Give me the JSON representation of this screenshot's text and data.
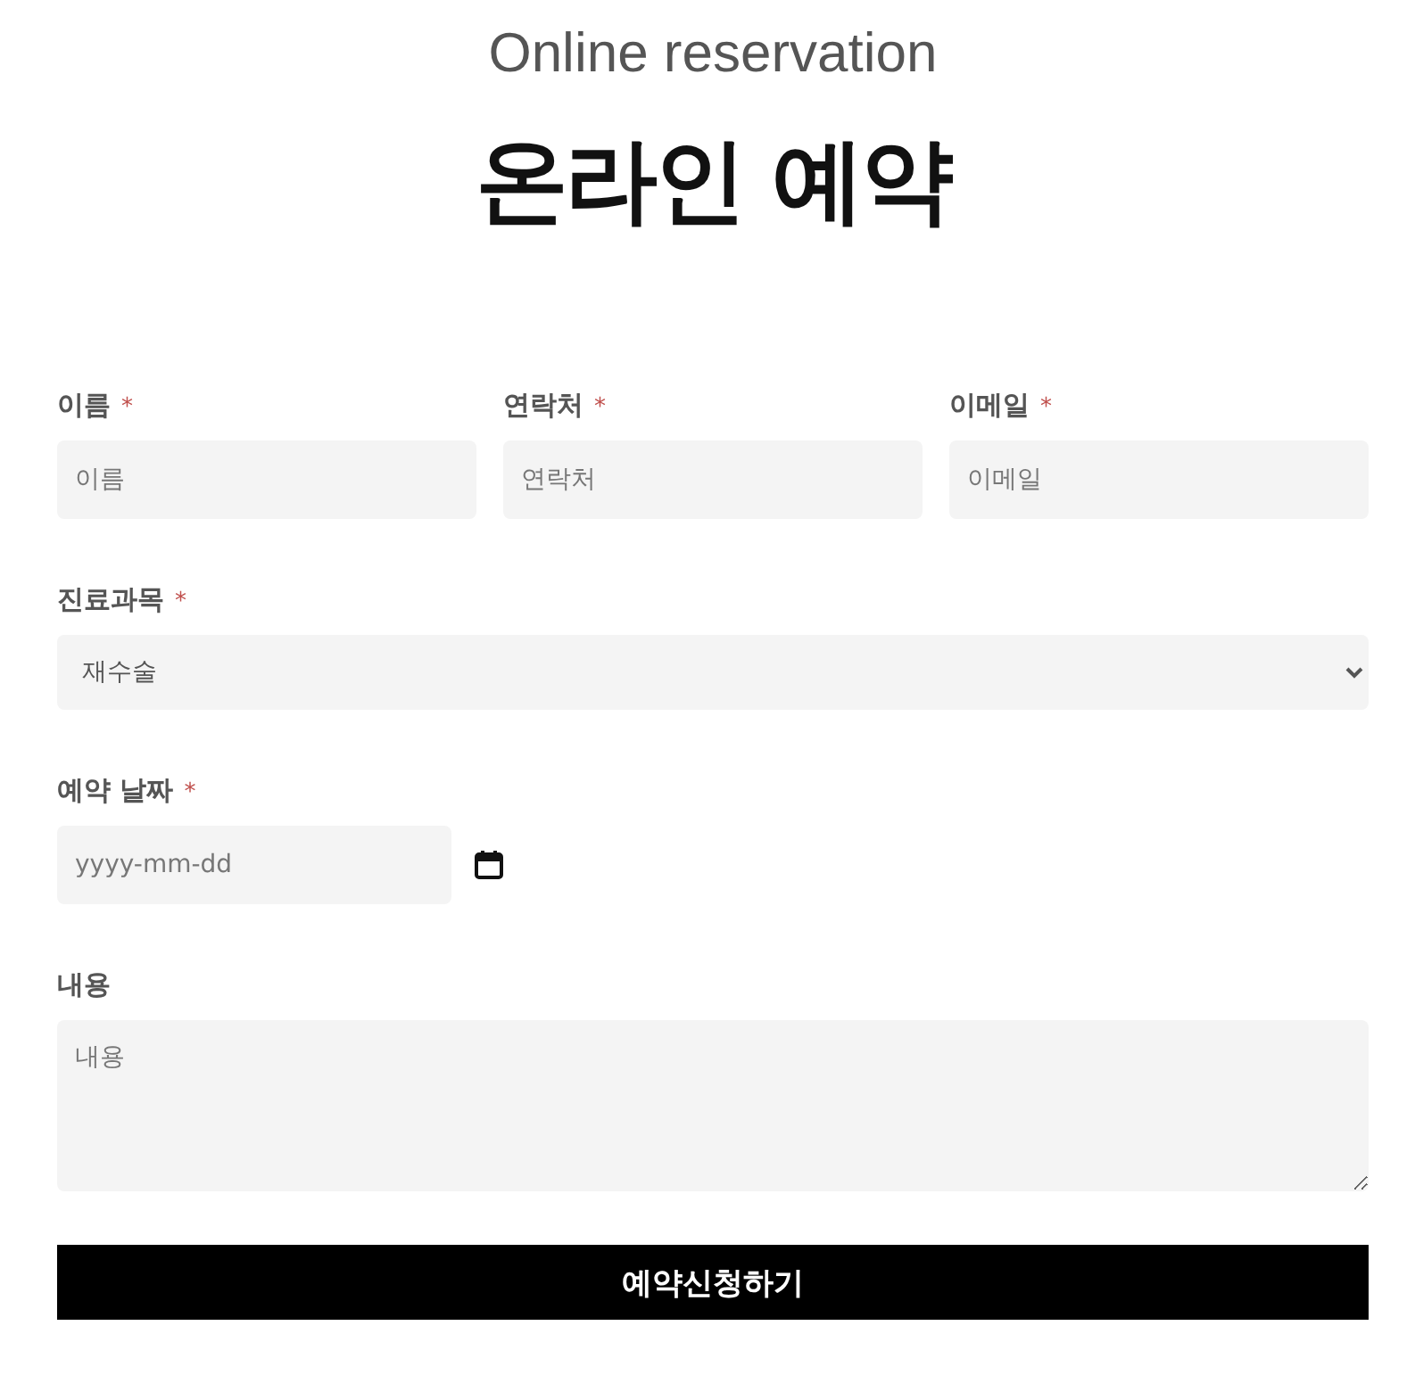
{
  "subtitle": "Online reservation",
  "title": "온라인 예약",
  "contact_fields": [
    {
      "label": "이름",
      "required_mark": "*",
      "placeholder": "이름"
    },
    {
      "label": "연락처",
      "required_mark": "*",
      "placeholder": "연락처"
    },
    {
      "label": "이메일",
      "required_mark": "*",
      "placeholder": "이메일"
    }
  ],
  "department": {
    "label": "진료과목",
    "required_mark": "*",
    "value": "재수술"
  },
  "date": {
    "label": "예약 날짜",
    "required_mark": "*",
    "placeholder": "yyyy-mm-dd"
  },
  "message": {
    "label": "내용",
    "placeholder": "내용"
  },
  "submit_button": "예약신청하기"
}
